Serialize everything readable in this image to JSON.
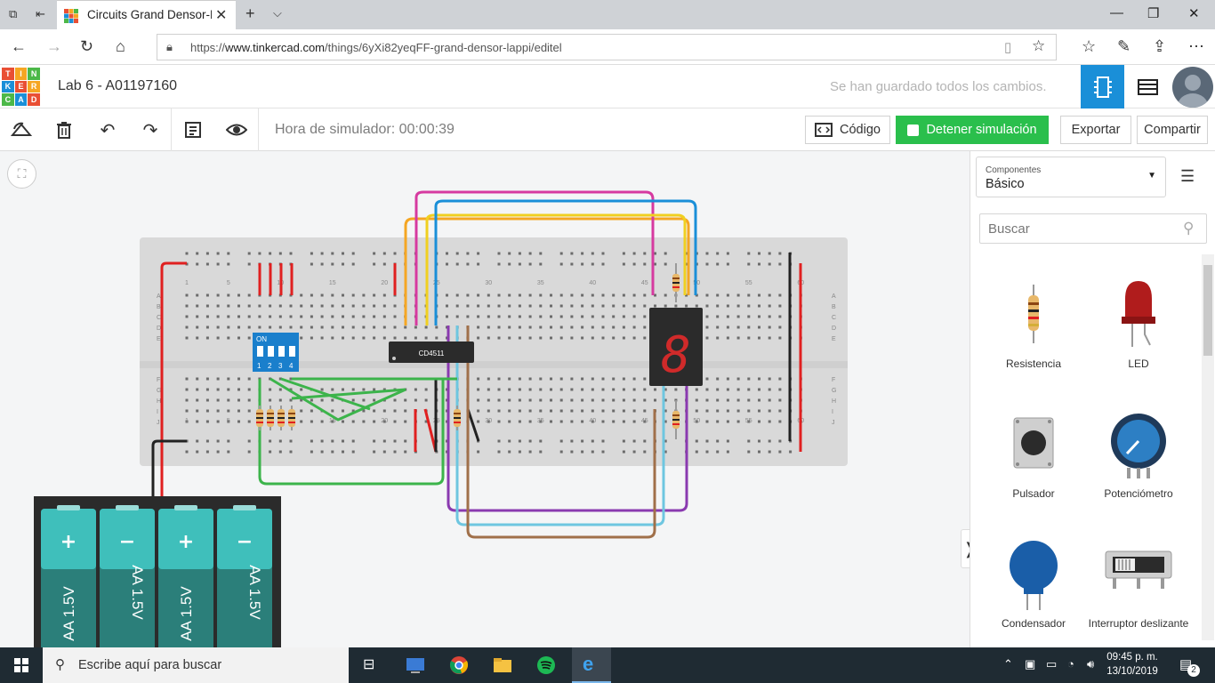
{
  "browser": {
    "tab_title": "Circuits Grand Densor-L",
    "url_prefix": "https://",
    "url_domain": "www.tinkercad.com",
    "url_path": "/things/6yXi82yeqFF-grand-densor-lappi/editel"
  },
  "app": {
    "logo_letters": [
      "TIN",
      "KER",
      "CAD"
    ],
    "project_title": "Lab 6 - A01197160",
    "save_status": "Se han guardado todos los cambios."
  },
  "toolbar": {
    "sim_time": "Hora de simulador: 00:00:39",
    "code_label": "Código",
    "stop_label": "Detener simulación",
    "export_label": "Exportar",
    "share_label": "Compartir"
  },
  "circuit": {
    "dip_label": "ON",
    "dip_numbers": [
      "1",
      "2",
      "3",
      "4"
    ],
    "chip_label": "CD4511",
    "breadboard_rows": [
      "A",
      "B",
      "C",
      "D",
      "E",
      "F",
      "G",
      "H",
      "I",
      "J"
    ],
    "column_numbers": [
      "1",
      "5",
      "10",
      "15",
      "20",
      "25",
      "30",
      "35",
      "40",
      "45",
      "50",
      "55",
      "60"
    ],
    "battery_plus": "+",
    "battery_minus": "−",
    "battery_label": "AA 1.5V",
    "seven_seg_digit": "8"
  },
  "panel": {
    "components_small": "Componentes",
    "components_value": "Básico",
    "search_placeholder": "Buscar",
    "items": [
      {
        "label": "Resistencia"
      },
      {
        "label": "LED"
      },
      {
        "label": "Pulsador"
      },
      {
        "label": "Potenciómetro"
      },
      {
        "label": "Condensador"
      },
      {
        "label": "Interruptor deslizante"
      }
    ]
  },
  "taskbar": {
    "search_text": "Escribe aquí para buscar",
    "time": "09:45 p. m.",
    "date": "13/10/2019",
    "notifications": "2"
  },
  "colors": {
    "accent_blue": "#1a8fd8",
    "stop_green": "#2abf4c",
    "taskbar": "#1f2b33",
    "breadboard": "#d9d9d9"
  }
}
